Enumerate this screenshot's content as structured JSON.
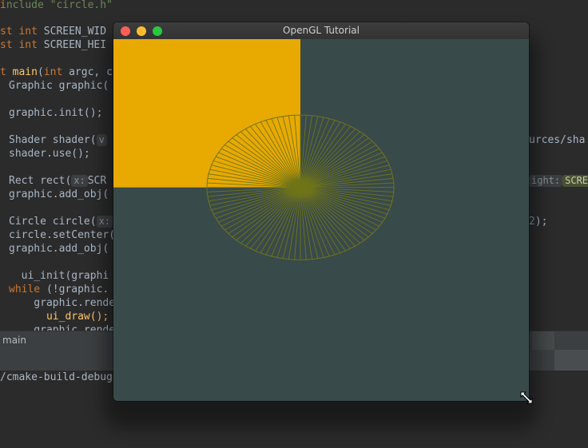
{
  "ide": {
    "code": {
      "include_line": "nclude \"circle.h\"",
      "const1": {
        "kw": "st int ",
        "name": "SCREEN_WID"
      },
      "const2": {
        "kw": "st int ",
        "name": "SCREEN_HEI"
      },
      "main": {
        "kw": "t ",
        "fn": "main",
        "rest": "(",
        "kw2": "int",
        "rest2": " argc, c"
      },
      "graphic_decl": "Graphic graphic(",
      "graphic_init": "graphic.init();",
      "shader_decl": "Shader shader(",
      "shader_hint": "v",
      "shader_tail": "urces/sha",
      "shader_use": "shader.use();",
      "rect_decl": "Rect rect(",
      "rect_hint_x": "x:",
      "rect_hint_val": "SCR",
      "rect_hint_right": "ight:",
      "rect_hint_right_val": "SCRE",
      "rect_add": "graphic.add_obj(",
      "circle_decl": "Circle circle(",
      "circle_hint": "x:",
      "circle_tail": "2);",
      "circle_center": "circle.setCenter(",
      "circle_add": "graphic.add_obj(",
      "ui_init": "  ui_init(graphi",
      "while_kw": "while",
      "while_rest": " (!graphic.",
      "render1": "    graphic.rende",
      "ui_draw": "      ui_draw();",
      "render2": "    graphic.rende"
    },
    "breadcrumb": "main",
    "terminal_path": "/cmake-build-debug"
  },
  "window": {
    "title": "OpenGL Tutorial",
    "canvas_bg": "#394a4a",
    "rect_color": "#e8a900",
    "circle_color": "#6f7419"
  },
  "scene": {
    "rect": {
      "x_from": -1,
      "x_to": -0.1,
      "y_from": 1,
      "y_to": 0.18
    },
    "circle": {
      "center_x": -0.1,
      "center_y": 0.18,
      "radius_x": 0.45,
      "radius_y": 0.4,
      "segments": 100
    }
  }
}
